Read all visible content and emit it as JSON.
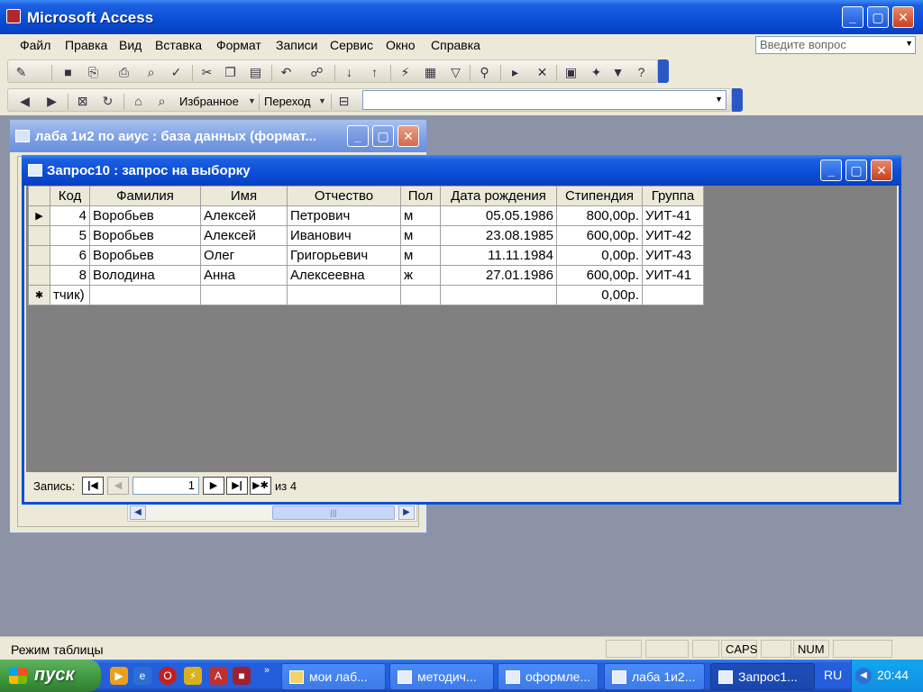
{
  "app": {
    "title": "Microsoft Access"
  },
  "menu": {
    "items": [
      "Файл",
      "Правка",
      "Вид",
      "Вставка",
      "Формат",
      "Записи",
      "Сервис",
      "Окно",
      "Справка"
    ],
    "help_placeholder": "Введите вопрос"
  },
  "toolbar2": {
    "favorites": "Избранное",
    "goto": "Переход"
  },
  "db_window": {
    "title": "лаба 1и2 по аиус : база данных (формат..."
  },
  "query_window": {
    "title": "Запрос10 : запрос на выборку",
    "columns": [
      "Код",
      "Фамилия",
      "Имя",
      "Отчество",
      "Пол",
      "Дата рождения",
      "Стипендия",
      "Группа"
    ],
    "rows": [
      [
        "4",
        "Воробьев",
        "Алексей",
        "Петрович",
        "м",
        "05.05.1986",
        "800,00р.",
        "УИТ-41"
      ],
      [
        "5",
        "Воробьев",
        "Алексей",
        "Иванович",
        "м",
        "23.08.1985",
        "600,00р.",
        "УИТ-42"
      ],
      [
        "6",
        "Воробьев",
        "Олег",
        "Григорьевич",
        "м",
        "11.11.1984",
        "0,00р.",
        "УИТ-43"
      ],
      [
        "8",
        "Володина",
        "Анна",
        "Алексеевна",
        "ж",
        "27.01.1986",
        "600,00р.",
        "УИТ-41"
      ]
    ],
    "new_row": [
      "тчик)",
      "",
      "",
      "",
      "",
      "",
      "0,00р.",
      ""
    ],
    "nav": {
      "label": "Запись:",
      "current": "1",
      "of": "из 4"
    }
  },
  "status": {
    "text": "Режим таблицы",
    "caps": "CAPS",
    "num": "NUM"
  },
  "taskbar": {
    "start": "пуск",
    "tasks": [
      "мои лаб...",
      "методич...",
      "оформле...",
      "лаба 1и2...",
      "Запрос1..."
    ],
    "lang": "RU",
    "clock": "20:44"
  }
}
